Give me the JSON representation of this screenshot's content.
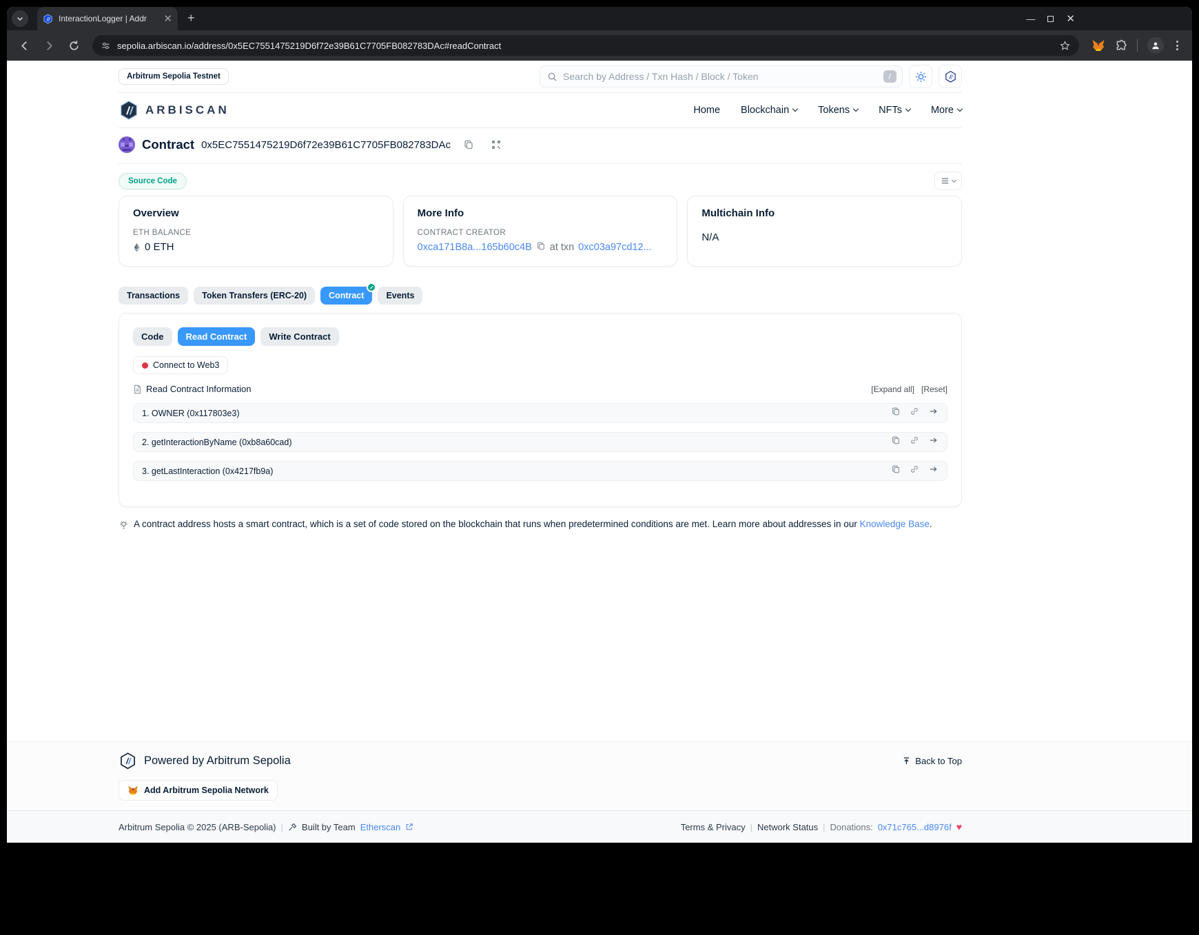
{
  "browser": {
    "tab_title": "InteractionLogger | Addr",
    "url": "sepolia.arbiscan.io/address/0x5EC7551475219D6f72e39B61C7705FB082783DAc#readContract"
  },
  "topbar": {
    "network_badge": "Arbitrum Sepolia Testnet",
    "search_placeholder": "Search by Address / Txn Hash / Block / Token",
    "search_shortcut": "/"
  },
  "nav": {
    "brand": "ARBISCAN",
    "items": [
      {
        "label": "Home"
      },
      {
        "label": "Blockchain"
      },
      {
        "label": "Tokens"
      },
      {
        "label": "NFTs"
      },
      {
        "label": "More"
      }
    ]
  },
  "contract": {
    "type_label": "Contract",
    "address": "0x5EC7551475219D6f72e39B61C7705FB082783DAc",
    "source_badge": "Source Code"
  },
  "cards": {
    "overview": {
      "title": "Overview",
      "balance_label": "ETH BALANCE",
      "balance_value": "0 ETH"
    },
    "more_info": {
      "title": "More Info",
      "creator_label": "CONTRACT CREATOR",
      "creator_address": "0xca171B8a...165b60c4B",
      "at_txn_label": "at txn",
      "creation_txn": "0xc03a97cd12..."
    },
    "multichain": {
      "title": "Multichain Info",
      "value": "N/A"
    }
  },
  "tabs": {
    "items": [
      {
        "label": "Transactions"
      },
      {
        "label": "Token Transfers (ERC-20)"
      },
      {
        "label": "Contract",
        "active": true
      },
      {
        "label": "Events"
      }
    ]
  },
  "contract_panel": {
    "subtabs": [
      {
        "label": "Code"
      },
      {
        "label": "Read Contract",
        "active": true
      },
      {
        "label": "Write Contract"
      }
    ],
    "connect_label": "Connect to Web3",
    "section_title": "Read Contract Information",
    "expand_all": "[Expand all]",
    "reset": "[Reset]",
    "functions": [
      "1. OWNER (0x117803e3)",
      "2. getInteractionByName (0xb8a60cad)",
      "3. getLastInteraction (0x4217fb9a)"
    ]
  },
  "help": {
    "text": "A contract address hosts a smart contract, which is a set of code stored on the blockchain that runs when predetermined conditions are met. Learn more about addresses in our ",
    "link": "Knowledge Base",
    "suffix": "."
  },
  "footer": {
    "powered_by": "Powered by Arbitrum Sepolia",
    "back_to_top": "Back to Top",
    "add_network": "Add Arbitrum Sepolia Network",
    "copyright": "Arbitrum Sepolia © 2025 (ARB-Sepolia)",
    "built_by": "Built by Team",
    "built_by_link": "Etherscan",
    "terms": "Terms & Privacy",
    "network_status": "Network Status",
    "donations_label": "Donations:",
    "donation_address": "0x71c765...d8976f"
  },
  "colors": {
    "accent_blue": "#3898fc",
    "link_blue": "#4a89f3",
    "green": "#00a186",
    "red": "#dc3545",
    "dark_text": "#081d35",
    "gray_text": "#6c757d"
  }
}
